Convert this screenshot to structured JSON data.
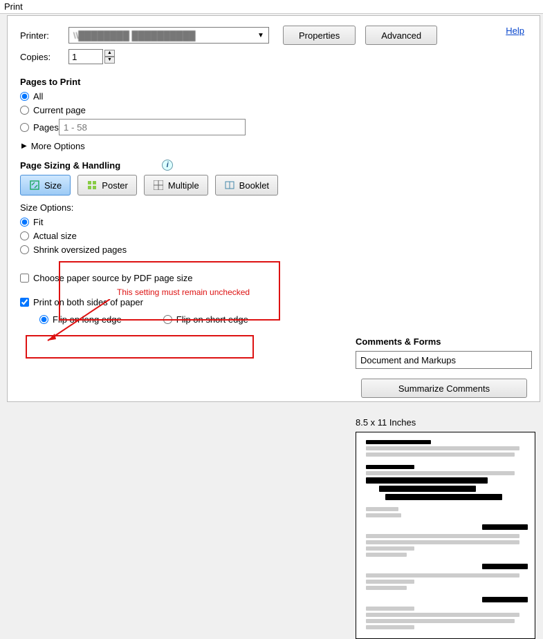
{
  "window_title": "Print",
  "help_link": "Help",
  "printer": {
    "label": "Printer:",
    "value": "\\\\████████ ██████████",
    "properties_btn": "Properties",
    "advanced_btn": "Advanced"
  },
  "copies": {
    "label": "Copies:",
    "value": "1"
  },
  "pages_to_print": {
    "heading": "Pages to Print",
    "all": "All",
    "current": "Current page",
    "pages_label": "Pages",
    "pages_placeholder": "1 - 58",
    "more_options": "More Options"
  },
  "sizing": {
    "heading": "Page Sizing & Handling",
    "tabs": {
      "size": "Size",
      "poster": "Poster",
      "multiple": "Multiple",
      "booklet": "Booklet"
    },
    "options_label": "Size Options:",
    "fit": "Fit",
    "actual": "Actual size",
    "shrink": "Shrink oversized pages",
    "paper_source": "Choose paper source by PDF page size",
    "duplex": "Print on both sides of paper",
    "flip_long": "Flip on long edge",
    "flip_short": "Flip on short edge"
  },
  "comments": {
    "heading": "Comments & Forms",
    "selected": "Document and Markups",
    "summarize_btn": "Summarize Comments"
  },
  "preview_dims": "8.5 x 11 Inches",
  "annotation": "This setting must remain unchecked"
}
